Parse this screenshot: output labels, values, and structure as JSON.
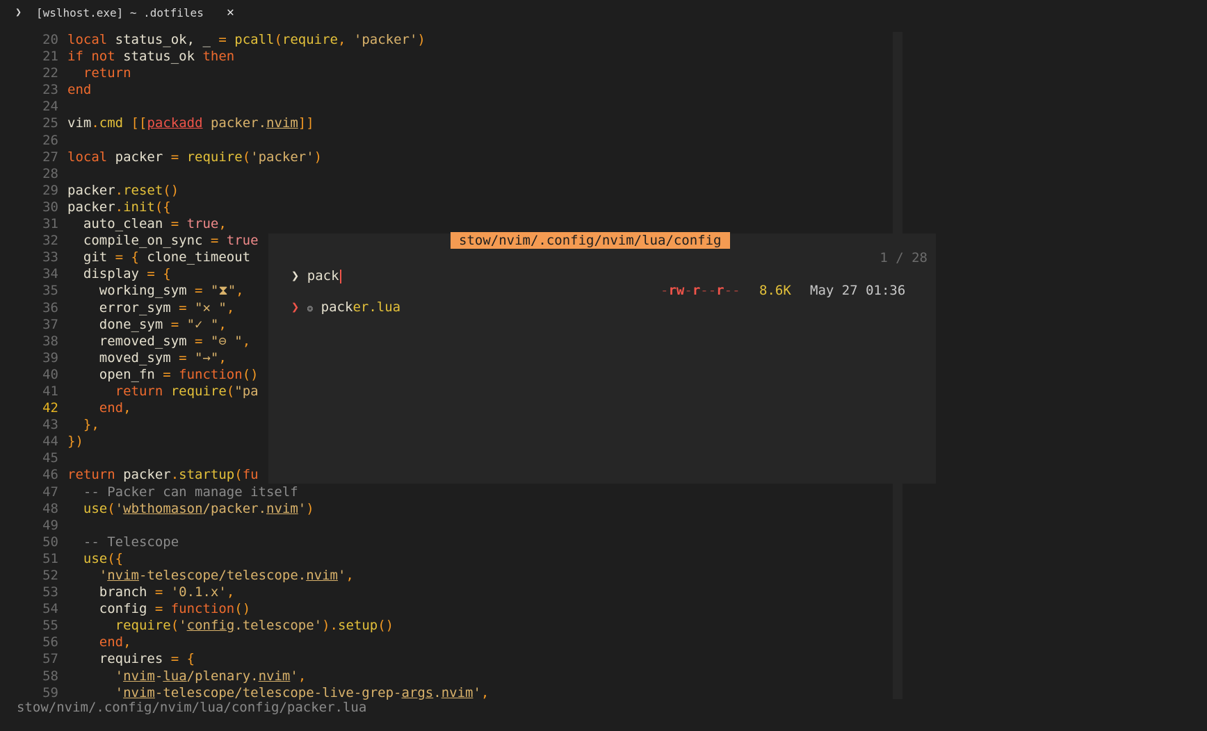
{
  "window": {
    "prompt_glyph": "❯",
    "title": "[wslhost.exe] ~ .dotfiles",
    "close_glyph": "✕"
  },
  "editor": {
    "current_line": 42,
    "lines": [
      {
        "n": 20,
        "tokens": [
          [
            "k",
            "local "
          ],
          [
            "v",
            "status_ok, _ "
          ],
          [
            "p",
            "= "
          ],
          [
            "f",
            "pcall"
          ],
          [
            "p",
            "("
          ],
          [
            "f",
            "require"
          ],
          [
            "p",
            ", "
          ],
          [
            "s",
            "'packer'"
          ],
          [
            "p",
            ")"
          ]
        ]
      },
      {
        "n": 21,
        "tokens": [
          [
            "k",
            "if "
          ],
          [
            "k",
            "not "
          ],
          [
            "v",
            "status_ok "
          ],
          [
            "k",
            "then"
          ]
        ]
      },
      {
        "n": 22,
        "tokens": [
          [
            "v",
            "  "
          ],
          [
            "k",
            "return"
          ]
        ]
      },
      {
        "n": 23,
        "tokens": [
          [
            "k",
            "end"
          ]
        ]
      },
      {
        "n": 24,
        "tokens": []
      },
      {
        "n": 25,
        "tokens": [
          [
            "v",
            "vim"
          ],
          [
            "p",
            "."
          ],
          [
            "f",
            "cmd "
          ],
          [
            "p",
            "[["
          ],
          [
            "ku",
            "packadd"
          ],
          [
            "s",
            " packer."
          ],
          [
            "su",
            "nvim"
          ],
          [
            "p",
            "]]"
          ]
        ]
      },
      {
        "n": 26,
        "tokens": []
      },
      {
        "n": 27,
        "tokens": [
          [
            "k",
            "local "
          ],
          [
            "v",
            "packer "
          ],
          [
            "p",
            "= "
          ],
          [
            "f",
            "require"
          ],
          [
            "p",
            "("
          ],
          [
            "s",
            "'packer'"
          ],
          [
            "p",
            ")"
          ]
        ]
      },
      {
        "n": 28,
        "tokens": []
      },
      {
        "n": 29,
        "tokens": [
          [
            "v",
            "packer"
          ],
          [
            "p",
            "."
          ],
          [
            "f",
            "reset"
          ],
          [
            "p",
            "()"
          ]
        ]
      },
      {
        "n": 30,
        "tokens": [
          [
            "v",
            "packer"
          ],
          [
            "p",
            "."
          ],
          [
            "f",
            "init"
          ],
          [
            "p",
            "({"
          ]
        ]
      },
      {
        "n": 31,
        "tokens": [
          [
            "v",
            "  auto_clean "
          ],
          [
            "p",
            "= "
          ],
          [
            "b",
            "true"
          ],
          [
            "p",
            ","
          ]
        ]
      },
      {
        "n": 32,
        "tokens": [
          [
            "v",
            "  compile_on_sync "
          ],
          [
            "p",
            "= "
          ],
          [
            "b",
            "true"
          ]
        ]
      },
      {
        "n": 33,
        "tokens": [
          [
            "v",
            "  git "
          ],
          [
            "p",
            "= { "
          ],
          [
            "v",
            "clone_timeout"
          ]
        ]
      },
      {
        "n": 34,
        "tokens": [
          [
            "v",
            "  display "
          ],
          [
            "p",
            "= {"
          ]
        ]
      },
      {
        "n": 35,
        "tokens": [
          [
            "v",
            "    working_sym "
          ],
          [
            "p",
            "= "
          ],
          [
            "s",
            "\"⧗\""
          ],
          [
            "p",
            ","
          ]
        ]
      },
      {
        "n": 36,
        "tokens": [
          [
            "v",
            "    error_sym "
          ],
          [
            "p",
            "= "
          ],
          [
            "s",
            "\"✕ \""
          ],
          [
            "p",
            ","
          ]
        ]
      },
      {
        "n": 37,
        "tokens": [
          [
            "v",
            "    done_sym "
          ],
          [
            "p",
            "= "
          ],
          [
            "s",
            "\"✓ \""
          ],
          [
            "p",
            ","
          ]
        ]
      },
      {
        "n": 38,
        "tokens": [
          [
            "v",
            "    removed_sym "
          ],
          [
            "p",
            "= "
          ],
          [
            "s",
            "\"⊖ \""
          ],
          [
            "p",
            ","
          ]
        ]
      },
      {
        "n": 39,
        "tokens": [
          [
            "v",
            "    moved_sym "
          ],
          [
            "p",
            "= "
          ],
          [
            "s",
            "\"→\""
          ],
          [
            "p",
            ","
          ]
        ]
      },
      {
        "n": 40,
        "tokens": [
          [
            "v",
            "    open_fn "
          ],
          [
            "p",
            "= "
          ],
          [
            "k",
            "function"
          ],
          [
            "p",
            "()"
          ]
        ]
      },
      {
        "n": 41,
        "tokens": [
          [
            "v",
            "      "
          ],
          [
            "k",
            "return "
          ],
          [
            "f",
            "require"
          ],
          [
            "p",
            "("
          ],
          [
            "s",
            "\"pa"
          ]
        ]
      },
      {
        "n": 42,
        "tokens": [
          [
            "v",
            "    "
          ],
          [
            "k",
            "end"
          ],
          [
            "p",
            ","
          ]
        ]
      },
      {
        "n": 43,
        "tokens": [
          [
            "p",
            "  },"
          ]
        ]
      },
      {
        "n": 44,
        "tokens": [
          [
            "p",
            "})"
          ]
        ]
      },
      {
        "n": 45,
        "tokens": []
      },
      {
        "n": 46,
        "tokens": [
          [
            "k",
            "return "
          ],
          [
            "v",
            "packer"
          ],
          [
            "p",
            "."
          ],
          [
            "f",
            "startup"
          ],
          [
            "p",
            "("
          ],
          [
            "k",
            "fu"
          ]
        ]
      },
      {
        "n": 47,
        "tokens": [
          [
            "c",
            "  -- Packer can manage itself"
          ]
        ]
      },
      {
        "n": 48,
        "tokens": [
          [
            "v",
            "  "
          ],
          [
            "f",
            "use"
          ],
          [
            "p",
            "("
          ],
          [
            "s",
            "'"
          ],
          [
            "su",
            "wbthomason"
          ],
          [
            "s",
            "/packer."
          ],
          [
            "su",
            "nvim"
          ],
          [
            "s",
            "'"
          ],
          [
            "p",
            ")"
          ]
        ]
      },
      {
        "n": 49,
        "tokens": []
      },
      {
        "n": 50,
        "tokens": [
          [
            "c",
            "  -- Telescope"
          ]
        ]
      },
      {
        "n": 51,
        "tokens": [
          [
            "v",
            "  "
          ],
          [
            "f",
            "use"
          ],
          [
            "p",
            "({"
          ]
        ]
      },
      {
        "n": 52,
        "tokens": [
          [
            "v",
            "    "
          ],
          [
            "s",
            "'"
          ],
          [
            "su",
            "nvim"
          ],
          [
            "s",
            "-telescope/telescope."
          ],
          [
            "su",
            "nvim"
          ],
          [
            "s",
            "'"
          ],
          [
            "p",
            ","
          ]
        ]
      },
      {
        "n": 53,
        "tokens": [
          [
            "v",
            "    branch "
          ],
          [
            "p",
            "= "
          ],
          [
            "s",
            "'0.1.x'"
          ],
          [
            "p",
            ","
          ]
        ]
      },
      {
        "n": 54,
        "tokens": [
          [
            "v",
            "    config "
          ],
          [
            "p",
            "= "
          ],
          [
            "k",
            "function"
          ],
          [
            "p",
            "()"
          ]
        ]
      },
      {
        "n": 55,
        "tokens": [
          [
            "v",
            "      "
          ],
          [
            "f",
            "require"
          ],
          [
            "p",
            "("
          ],
          [
            "s",
            "'"
          ],
          [
            "su",
            "config"
          ],
          [
            "s",
            ".telescope'"
          ],
          [
            "p",
            ")."
          ],
          [
            "f",
            "setup"
          ],
          [
            "p",
            "()"
          ]
        ]
      },
      {
        "n": 56,
        "tokens": [
          [
            "v",
            "    "
          ],
          [
            "k",
            "end"
          ],
          [
            "p",
            ","
          ]
        ]
      },
      {
        "n": 57,
        "tokens": [
          [
            "v",
            "    requires "
          ],
          [
            "p",
            "= {"
          ]
        ]
      },
      {
        "n": 58,
        "tokens": [
          [
            "v",
            "      "
          ],
          [
            "s",
            "'"
          ],
          [
            "su",
            "nvim"
          ],
          [
            "s",
            "-"
          ],
          [
            "su",
            "lua"
          ],
          [
            "s",
            "/plenary."
          ],
          [
            "su",
            "nvim"
          ],
          [
            "s",
            "'"
          ],
          [
            "p",
            ","
          ]
        ]
      },
      {
        "n": 59,
        "tokens": [
          [
            "v",
            "      "
          ],
          [
            "s",
            "'"
          ],
          [
            "su",
            "nvim"
          ],
          [
            "s",
            "-telescope/telescope-live-grep-"
          ],
          [
            "su",
            "args"
          ],
          [
            "s",
            "."
          ],
          [
            "su",
            "nvim"
          ],
          [
            "s",
            "'"
          ],
          [
            "p",
            ","
          ]
        ]
      }
    ]
  },
  "statusline": {
    "path": "stow/nvim/.config/nvim/lua/config/packer.lua"
  },
  "picker": {
    "title": "stow/nvim/.config/nvim/lua/config",
    "prompt_prefix": "❯ ",
    "query": "pack",
    "counter": "1 / 28",
    "results": [
      {
        "caret": "❯ ",
        "icon": "❂",
        "name_match": "pack",
        "name_rest": "er.lua",
        "permissions": "-rw-r--r--",
        "size": "8.6K",
        "date": "May 27 01:36"
      }
    ]
  },
  "colors": {
    "background": "#1e1e1e",
    "keyword": "#ef6b2e",
    "function": "#e4c13a",
    "string": "#dab36b",
    "comment": "#8b8b8b",
    "picker_title_bg": "#f49b52",
    "current_line_number": "#e6b422"
  }
}
